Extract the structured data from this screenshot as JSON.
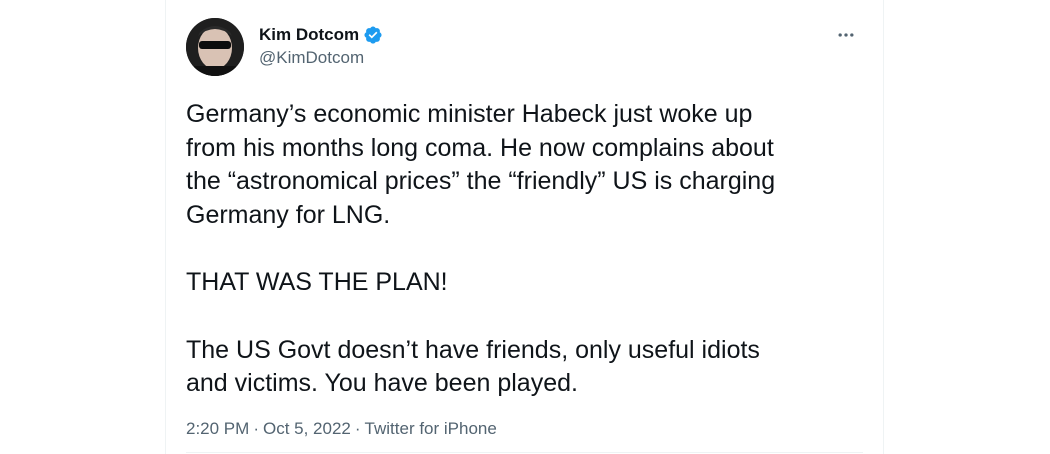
{
  "author": {
    "display_name": "Kim Dotcom",
    "handle": "@KimDotcom",
    "verified_icon": "verified-badge-icon",
    "avatar_icon": "avatar-image"
  },
  "tweet": {
    "paragraph_1_line_1": "Germany’s economic minister Habeck just woke up",
    "paragraph_1_line_2": "from his months long coma. He now complains about",
    "paragraph_1_line_3": "the “astronomical prices” the “friendly” US is charging",
    "paragraph_1_line_4": "Germany for LNG.",
    "paragraph_2": "THAT WAS THE PLAN!",
    "paragraph_3_line_1": "The US Govt doesn’t have friends, only useful idiots",
    "paragraph_3_line_2": "and victims. You have been played."
  },
  "meta": {
    "time": "2:20 PM",
    "separator": "·",
    "date": "Oct 5, 2022",
    "source": "Twitter for iPhone"
  },
  "colors": {
    "text_primary": "#0f1419",
    "text_secondary": "#536471",
    "verified_blue": "#1d9bf0",
    "border": "#eff3f4"
  },
  "more_icon": "more-horizontal-icon"
}
